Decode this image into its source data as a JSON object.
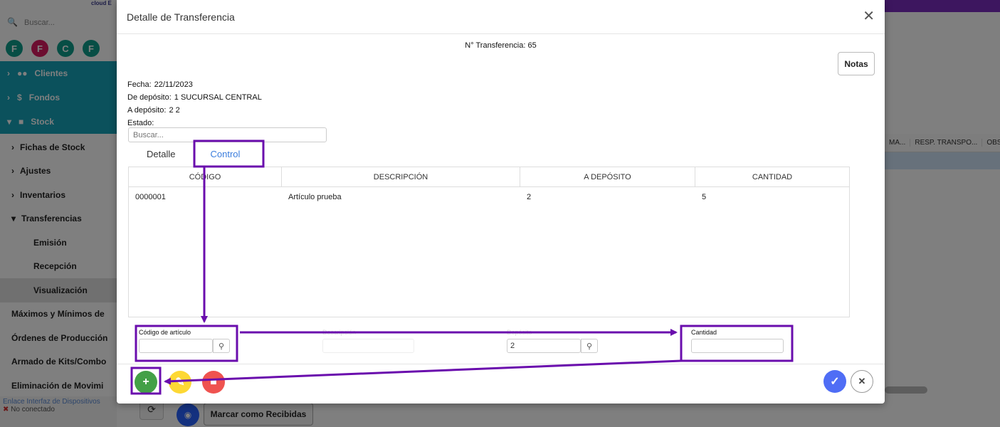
{
  "background": {
    "brand": "cloud E",
    "search_placeholder": "Buscar...",
    "avatars": [
      {
        "letter": "F",
        "color": "#0f9d8a"
      },
      {
        "letter": "F",
        "color": "#d81b60"
      },
      {
        "letter": "C",
        "color": "#0f9d8a"
      },
      {
        "letter": "F",
        "color": "#0f9d8a"
      }
    ],
    "main_nav": [
      {
        "label": "Clientes",
        "icon": "users-icon"
      },
      {
        "label": "Fondos",
        "icon": "dollar-icon"
      },
      {
        "label": "Stock",
        "icon": "box-icon"
      }
    ],
    "stock_nav": [
      {
        "label": "Fichas de Stock",
        "sub": false
      },
      {
        "label": "Ajustes",
        "sub": false
      },
      {
        "label": "Inventarios",
        "sub": false
      },
      {
        "label": "Transferencias",
        "sub": false
      },
      {
        "label": "Emisión",
        "sub": true
      },
      {
        "label": "Recepción",
        "sub": true
      },
      {
        "label": "Visualización",
        "sub": true,
        "active": true
      },
      {
        "label": "Máximos y Mínimos de",
        "sub": false
      },
      {
        "label": "Órdenes de Producción",
        "sub": false
      },
      {
        "label": "Armado de Kits/Combo",
        "sub": false
      },
      {
        "label": "Eliminación de Movimi",
        "sub": false
      }
    ],
    "status_link": "Enlace Interfaz de Dispositivos",
    "status_text": "No conectado",
    "table_headers": [
      "MA...",
      "RESP. TRANSPO...",
      "OBS"
    ],
    "mark_received_label": "Marcar como Recibidas"
  },
  "modal": {
    "title": "Detalle de Transferencia",
    "transfer_number": "N° Transferencia: 65",
    "notes_label": "Notas",
    "info": {
      "fecha_label": "Fecha:",
      "fecha_value": "22/11/2023",
      "de_deposito_label": "De depósito:",
      "de_deposito_value": "1  SUCURSAL CENTRAL",
      "a_deposito_label": "A depósito:",
      "a_deposito_value": "2  2",
      "estado_label": "Estado:"
    },
    "search_placeholder": "Buscar...",
    "tabs": [
      "Detalle",
      "Control"
    ],
    "table": {
      "headers": [
        "CÓDIGO",
        "DESCRIPCIÓN",
        "A DEPÓSITO",
        "CANTIDAD"
      ],
      "rows": [
        [
          "0000001",
          "Artículo prueba",
          "2",
          "5"
        ]
      ]
    },
    "form": {
      "codigo_label": "Código de artículo",
      "descripcion_label": "Descripción",
      "deposito_label": "Depósito",
      "deposito_value": "2",
      "cantidad_label": "Cantidad"
    }
  },
  "annotation_color": "#6a0dad"
}
